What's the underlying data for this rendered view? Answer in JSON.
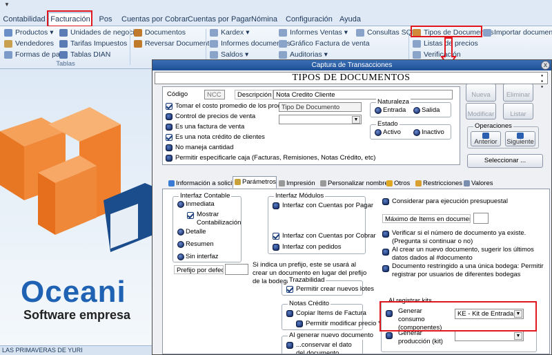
{
  "menu_tabs": [
    "Contabilidad",
    "Facturación",
    "Pos",
    "Cuentas por Cobrar",
    "Cuentas por Pagar",
    "Nómina",
    "Configuración",
    "Ayuda"
  ],
  "ribbon": {
    "col1": [
      "Productos",
      "Vendedores",
      "Formas de pago"
    ],
    "col1_arrow": "▾",
    "col2": [
      "Unidades de negocio",
      "Tarifas Impuestos",
      "Tablas DIAN"
    ],
    "col3": [
      "Documentos",
      "Reversar Documentos"
    ],
    "col4": [
      "Kardex",
      "Informes documentos",
      "Saldos"
    ],
    "col5": [
      "Informes Ventas",
      "Gráfico Factura de venta",
      "Auditorias"
    ],
    "col6": [
      "Consultas SQL"
    ],
    "col7": [
      "Tipos de Documentos",
      "Listas de precios",
      "Verificación"
    ],
    "col8": [
      "Importar documentos"
    ],
    "group_label": "Tablas"
  },
  "logo": {
    "text": "Oceani",
    "subtitle": "Software empresa"
  },
  "status_text": "LAS PRIMAVERAS DE YURI",
  "dialog": {
    "title": "Captura de Transacciones",
    "close": "x",
    "heading": "TIPOS DE DOCUMENTOS",
    "codigo_label": "Código",
    "codigo_value": "NCC",
    "descripcion_label": "Descripción",
    "descripcion_value": "Nota Credito Cliente",
    "options": [
      {
        "label": "Tomar el costo promedio de los productos",
        "checked": true
      },
      {
        "label": "Control de precios de venta",
        "checked": false
      },
      {
        "label": "Es una factura de venta",
        "checked": false
      },
      {
        "label": "Es una nota crédito de clientes",
        "checked": true
      },
      {
        "label": "No maneja cantidad",
        "checked": false
      },
      {
        "label": "Permitir especificarle caja  (Facturas, Remisiones, Notas Crédito, etc)",
        "checked": false
      }
    ],
    "tipo_doc_label": "Tipo De Documento",
    "naturaleza": {
      "title": "Naturaleza",
      "opt1": "Entrada",
      "opt2": "Salida"
    },
    "estado": {
      "title": "Estado",
      "opt1": "Activo",
      "opt2": "Inactivo"
    },
    "buttons": {
      "nueva": "Nueva",
      "eliminar": "Eliminar",
      "modificar": "Modificar",
      "listar": "Listar",
      "operaciones": "Operaciones",
      "anterior": "Anterior",
      "siguiente": "Siguiente",
      "seleccionar": "Seleccionar ..."
    },
    "tabs": [
      "Información a solicitar",
      "Parámetros",
      "Impresión",
      "Personalizar nombres",
      "Otros",
      "Restricciones",
      "Valores"
    ],
    "params": {
      "interfaz_contable": {
        "title": "Interfaz Contable",
        "items": [
          "Inmediata",
          "Mostrar Contabilización",
          "Detalle",
          "Resumen",
          "Sin interfaz"
        ]
      },
      "interfaz_modulos": {
        "title": "Interfaz Módulos",
        "items": [
          "Interfaz con Cuentas por Pagar",
          "Interfaz con Cuentas por Cobrar",
          "Interfaz con pedidos"
        ]
      },
      "presupuestal": "Considerar para ejecución presupuestal",
      "maximo_items": "Máximo de Items en documento",
      "verificar": "Verificar si el número de documento ya existe. (Pregunta si continuar o no)",
      "sugerir": "Al crear un nuevo documento, sugerir los últimos datos dados al #documento",
      "restringido": "Documento restringido a una única bodega: Permitir registrar por usuarios de diferentes bodegas",
      "prefijo_label": "Prefijo por defecto",
      "prefijo_help": "Si indica un prefijo, este se usará al crear un documento en lugar del prefijo de la bodega de",
      "trazabilidad": {
        "title": "Trazabilidad",
        "item": "Permitir crear nuevos lotes"
      },
      "notas_credito": {
        "title": "Notas Crédito",
        "item1": "Copiar Items de Factura",
        "item2": "Permitir modificar precio *"
      },
      "nuevo_doc": {
        "title": "Al generar nuevo documento",
        "item": "...conservar el dato del documento externo"
      },
      "kits": {
        "title": "Al registrar kits",
        "generar_consumo": "Generar consumo (componentes)",
        "consumo_value": "KE - Kit de Entrada",
        "generar_produccion": "Generar producción (kit)"
      }
    }
  }
}
